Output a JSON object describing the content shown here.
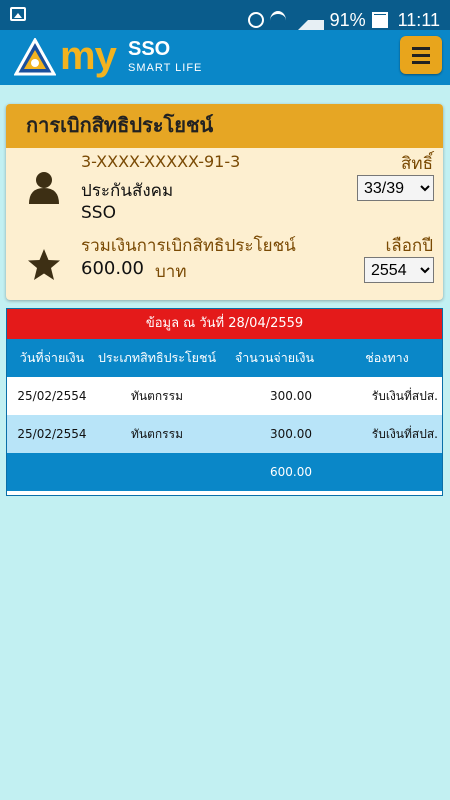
{
  "status": {
    "battery": "91%",
    "time": "11:11"
  },
  "header": {
    "logo_my": "my",
    "logo_sso": "SSO",
    "logo_sub": "SMART LIFE"
  },
  "card": {
    "title": "การเบิกสิทธิประโยชน์",
    "id_masked": "3-XXXX-XXXXX-91-3",
    "rights_label": "สิทธิ์",
    "rights_selected": "33/39",
    "insurance_label": "ประกันสังคม",
    "insurance_org": "SSO",
    "total_label": "รวมเงินการเบิกสิทธิประโยชน์",
    "year_label": "เลือกปี",
    "total_amount": "600.00",
    "currency": "บาท",
    "year_selected": "2554"
  },
  "table": {
    "banner": "ข้อมูล ณ วันที่ 28/04/2559",
    "headers": [
      "วันที่จ่ายเงิน",
      "ประเภทสิทธิประโยชน์",
      "จำนวนจ่ายเงิน",
      "ช่องทาง"
    ],
    "rows": [
      [
        "25/02/2554",
        "ทันตกรรม",
        "300.00",
        "รับเงินที่สปส."
      ],
      [
        "25/02/2554",
        "ทันตกรรม",
        "300.00",
        "รับเงินที่สปส."
      ]
    ],
    "total": "600.00"
  },
  "colors": {
    "statusbar": "#0a5c8c",
    "header": "#0a87c8",
    "accent": "#e6a624",
    "background": "#c2f0f2",
    "banner_red": "#e41a1a"
  }
}
